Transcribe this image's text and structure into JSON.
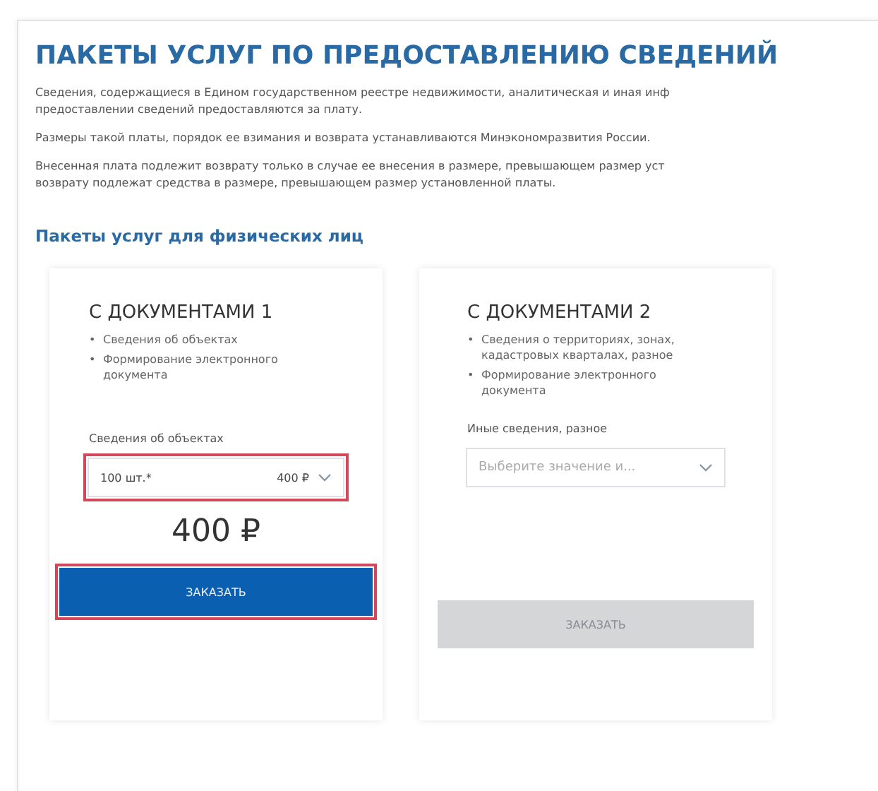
{
  "title": "ПАКЕТЫ УСЛУГ ПО ПРЕДОСТАВЛЕНИЮ СВЕДЕНИЙ",
  "paragraphs": [
    {
      "lines": [
        "Сведения, содержащиеся в Едином государственном реестре недвижимости, аналитическая и иная инф",
        "предоставлении сведений предоставляются за плату."
      ]
    },
    {
      "lines": [
        "Размеры такой платы, порядок ее взимания и возврата устанавливаются Минэкономразвития России."
      ]
    },
    {
      "lines": [
        "Внесенная плата подлежит возврату только в случае ее внесения в размере, превышающем размер уст",
        "возврату подлежат средства в размере, превышающем размер установленной платы."
      ]
    }
  ],
  "section_title": "Пакеты услуг для физических лиц",
  "packages": [
    {
      "title": "С ДОКУМЕНТАМИ 1",
      "features": [
        {
          "bullet": "•",
          "text": "Сведения об объектах"
        },
        {
          "bullet": "•",
          "text": "Формирование электронного документа"
        }
      ],
      "select_label": "Сведения об объектах",
      "select": {
        "value": "100 шт.*",
        "price": "400 ₽",
        "highlighted": true
      },
      "price": "400 ₽",
      "button": {
        "label": "ЗАКАЗАТЬ",
        "disabled": false,
        "highlighted": true
      }
    },
    {
      "title": "С ДОКУМЕНТАМИ 2",
      "features": [
        {
          "bullet": "•",
          "text": "Сведения о территориях, зонах, кадастровых кварталах, разное"
        },
        {
          "bullet": "•",
          "text": "Формирование электронного документа"
        }
      ],
      "select_label": "Иные сведения, разное",
      "select": {
        "placeholder": "Выберите значение и...",
        "highlighted": false
      },
      "button": {
        "label": "ЗАКАЗАТЬ",
        "disabled": true,
        "highlighted": false
      }
    }
  ]
}
